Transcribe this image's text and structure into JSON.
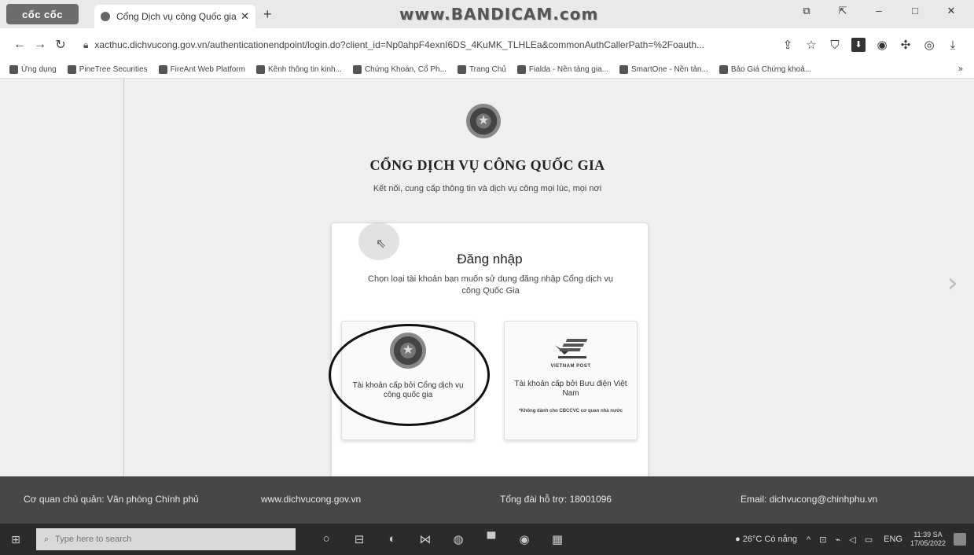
{
  "browser": {
    "logo": "cốc cốc",
    "tab_title": "Cổng Dịch vụ công Quốc gia",
    "tab_close": "✕",
    "new_tab": "+",
    "watermark": "www.BANDICAM.com",
    "url": "xacthuc.dichvucong.gov.vn/authenticationendpoint/login.do?client_id=Np0ahpF4exnI6DS_4KuMK_TLHLEa&commonAuthCallerPath=%2Foauth..."
  },
  "bookmarks": [
    "Ứng dụng",
    "PineTree Securities",
    "FireAnt Web Platform",
    "Kênh thông tin kinh...",
    "Chứng Khoán, Cổ Ph...",
    "Trang Chủ",
    "Fialda - Nền tảng gia...",
    "SmartOne - Nền tản...",
    "Bảo Giá Chứng khoả..."
  ],
  "bookmarks_more": "»",
  "portal": {
    "title": "CỔNG DỊCH VỤ CÔNG QUỐC GIA",
    "subtitle": "Kết nối, cung cấp thông tin và dịch vụ công mọi lúc, mọi nơi"
  },
  "login": {
    "title": "Đăng nhập",
    "description": "Chọn loại tài khoản bạn muốn sử dụng đăng nhập Cổng dịch vụ công Quốc Gia",
    "option_gov": "Tài khoản cấp bởi Cổng dịch vụ công quốc gia",
    "option_post_logo": "VIETNAM POST",
    "option_post": "Tài khoản cấp bởi Bưu điện Việt Nam",
    "option_post_note": "*Không dành cho CBCCVC cơ quan nhà nước"
  },
  "footer": {
    "agency": "Cơ quan chủ quản: Văn phòng Chính phủ",
    "website": "www.dichvucong.gov.vn",
    "hotline": "Tổng đài hỗ trợ: 18001096",
    "email": "Email: dichvucong@chinhphu.vn"
  },
  "taskbar": {
    "search_placeholder": "Type here to search",
    "weather": "26°C Có nắng",
    "language": "ENG",
    "time": "11:39 SA",
    "date": "17/05/2022"
  }
}
